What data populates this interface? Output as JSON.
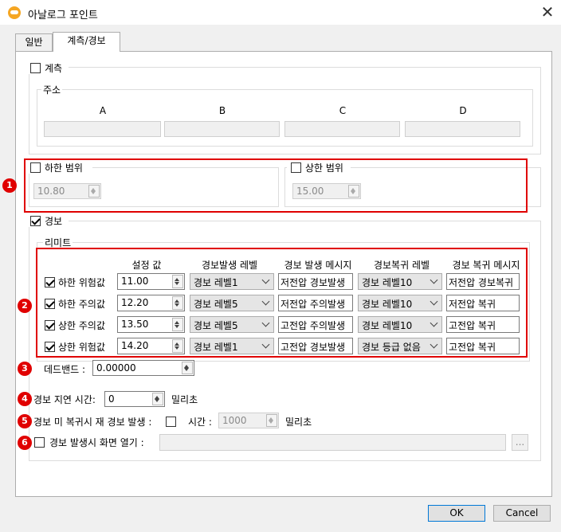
{
  "window": {
    "title": "아날로그 포인트"
  },
  "tabs": [
    {
      "label": "일반"
    },
    {
      "label": "계측/경보"
    }
  ],
  "measure": {
    "checkbox_label": "계측",
    "address_group": "주소",
    "address_columns": [
      {
        "label": "A",
        "value": ""
      },
      {
        "label": "B",
        "value": ""
      },
      {
        "label": "C",
        "value": ""
      },
      {
        "label": "D",
        "value": ""
      }
    ]
  },
  "range": {
    "low_label": "하한 범위",
    "low_value": "10.80",
    "high_label": "상한 범위",
    "high_value": "15.00"
  },
  "alarm": {
    "checkbox_label": "경보",
    "limit_group": "리미트",
    "headers": {
      "setting": "설정 값",
      "level": "경보발생 레벨",
      "message": "경보 발생 메시지",
      "recover_level": "경보복귀 레벨",
      "recover_message": "경보 복귀 메시지"
    },
    "rows": [
      {
        "label": "하한 위험값",
        "checked": true,
        "value": "11.00",
        "level": "경보 레벨1",
        "message": "저전압 경보발생",
        "recover_level": "경보 레벨10",
        "recover_message": "저전압 경보복귀"
      },
      {
        "label": "하한 주의값",
        "checked": true,
        "value": "12.20",
        "level": "경보 레벨5",
        "message": "저전압 주의발생",
        "recover_level": "경보 레벨10",
        "recover_message": "저전압 복귀"
      },
      {
        "label": "상한 주의값",
        "checked": true,
        "value": "13.50",
        "level": "경보 레벨5",
        "message": "고전압 주의발생",
        "recover_level": "경보 레벨10",
        "recover_message": "고전압 복귀"
      },
      {
        "label": "상한 위험값",
        "checked": true,
        "value": "14.20",
        "level": "경보 레벨1",
        "message": "고전압 경보발생",
        "recover_level": "경보 등급 없음",
        "recover_message": "고전압 복귀"
      }
    ],
    "deadband_label": "데드밴드 :",
    "deadband_value": "0.00000"
  },
  "delay": {
    "label": "경보 지연 시간:",
    "value": "0",
    "unit": "밀리초"
  },
  "realarm": {
    "label": "경보 미 복귀시 재 경보 발생 :",
    "time_label": "시간 :",
    "time_value": "1000",
    "unit": "밀리초"
  },
  "open_screen": {
    "label": "경보 발생시 화면 열기 :",
    "path": "",
    "browse": "..."
  },
  "badges": [
    "1",
    "2",
    "3",
    "4",
    "5",
    "6"
  ],
  "buttons": {
    "ok": "OK",
    "cancel": "Cancel"
  },
  "colors": {
    "highlight": "#e00000",
    "focus_border": "#0078d7"
  }
}
